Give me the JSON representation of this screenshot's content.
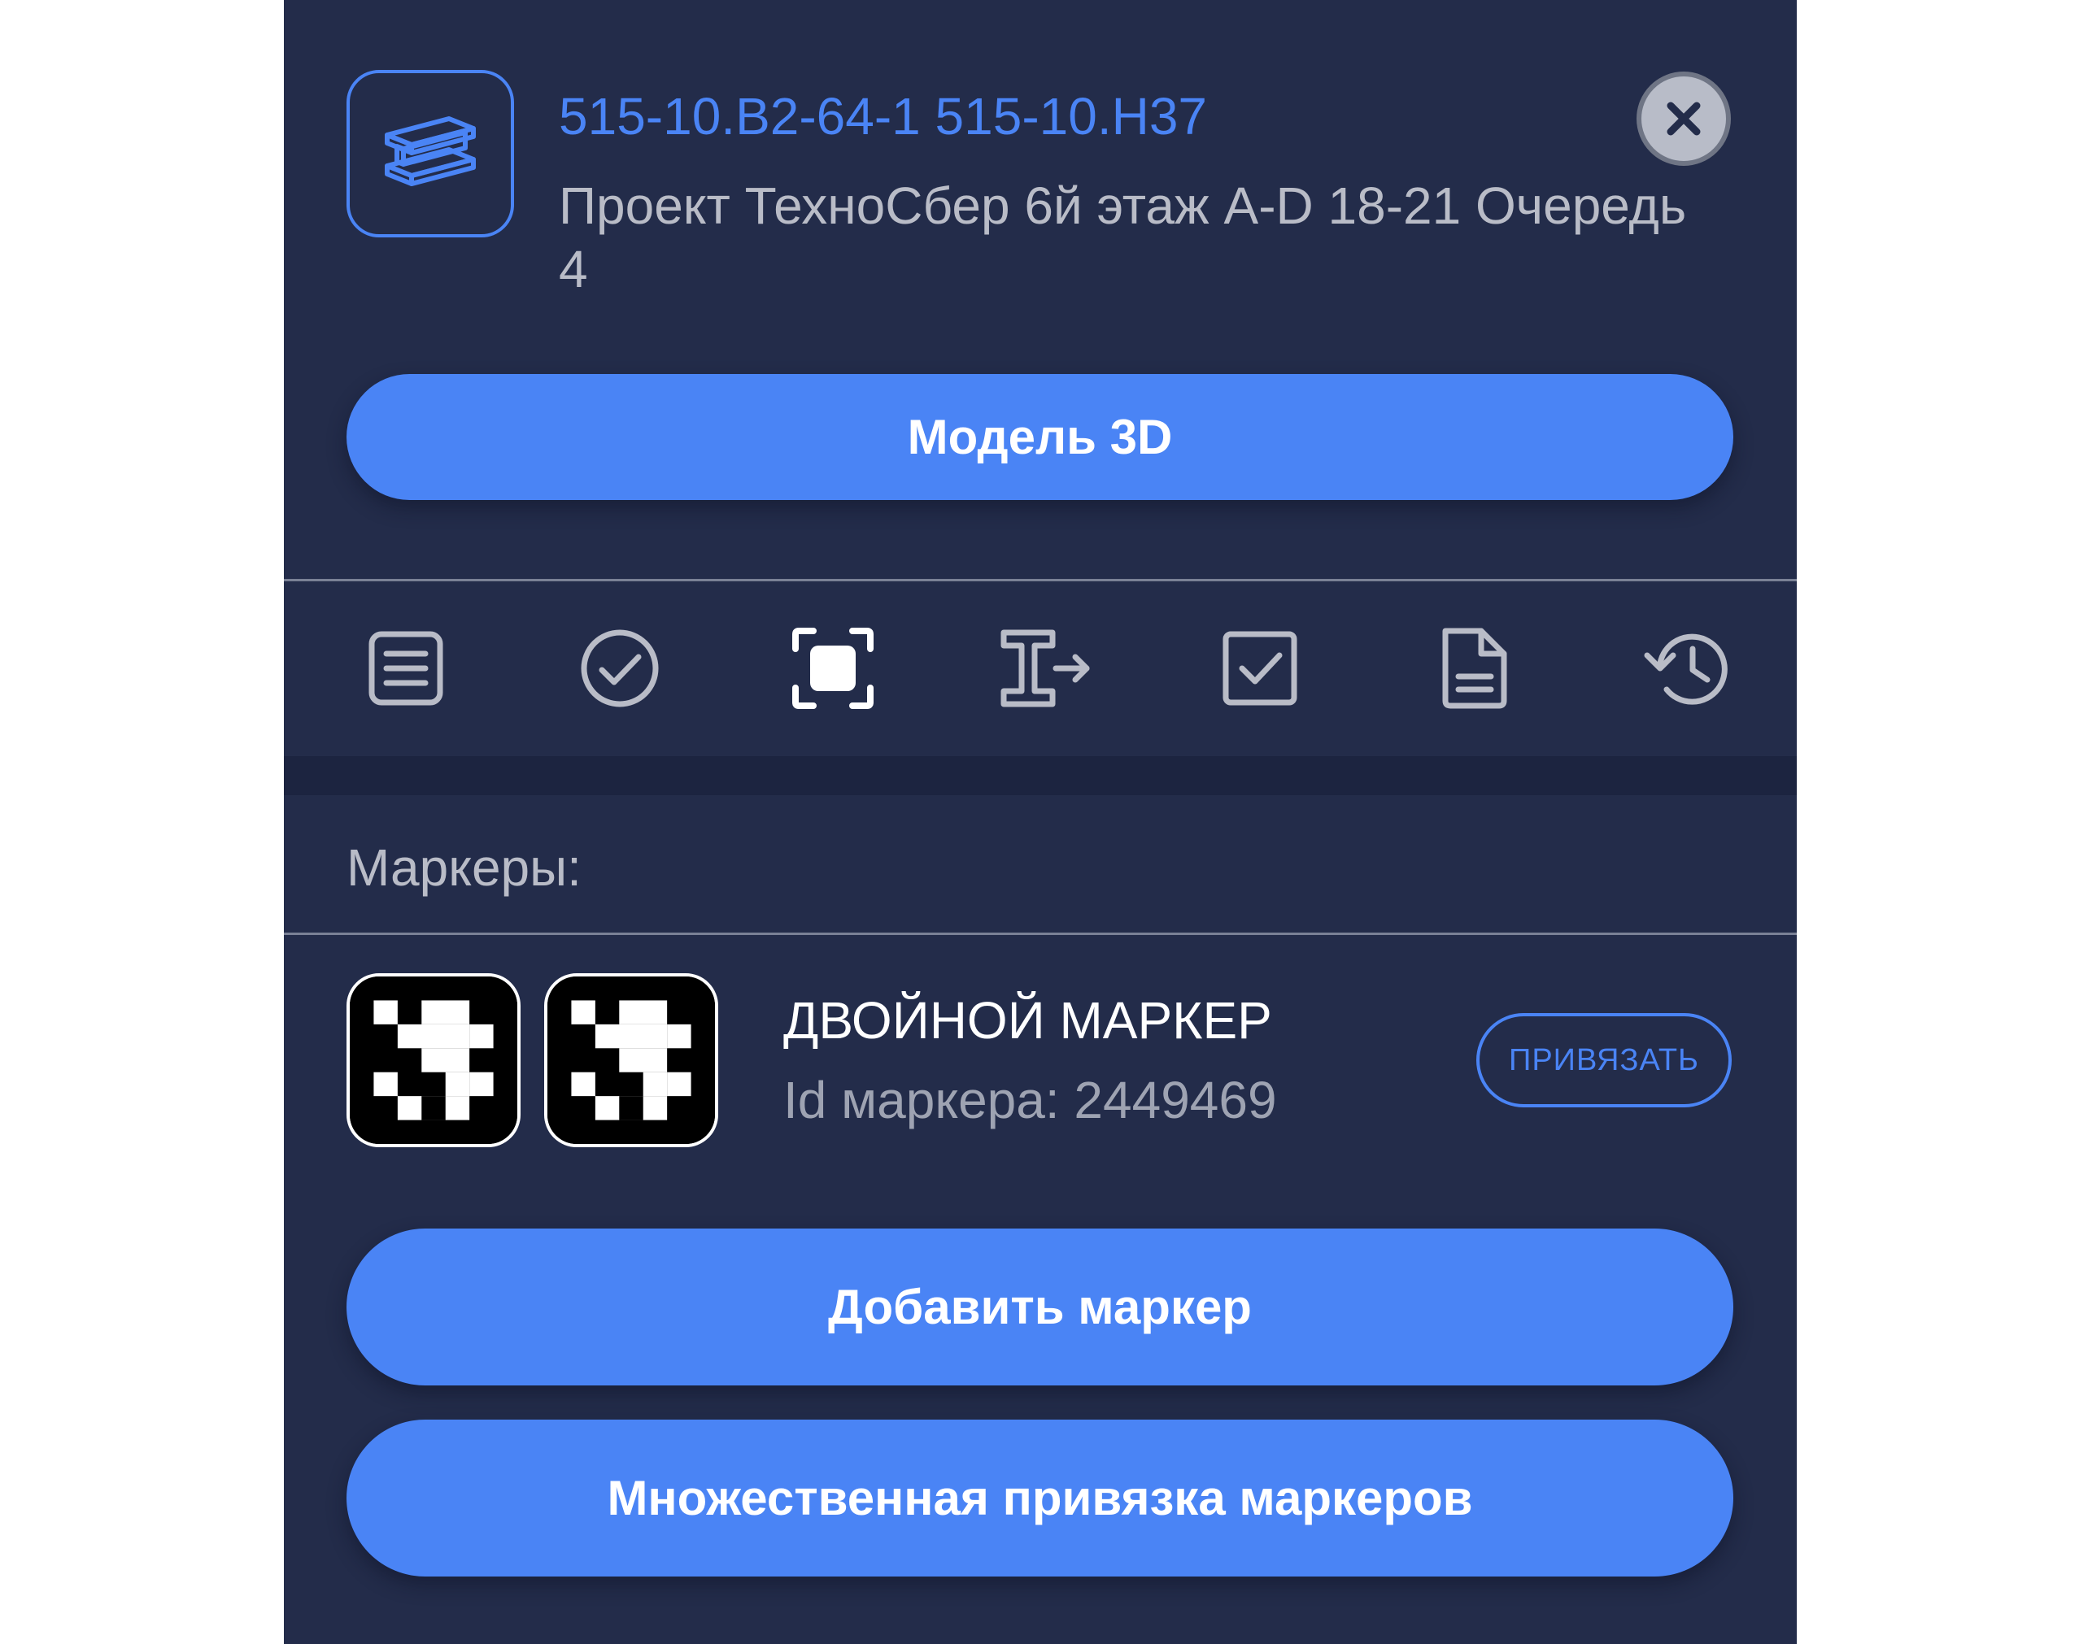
{
  "header": {
    "element_code": "515-10.B2-64-1 515-10.H37",
    "element_description": "Проект ТехноСбер 6й этаж A-D 18-21 Очередь 4",
    "element_icon": "steel-beam-icon",
    "close_icon": "close-icon"
  },
  "actions": {
    "model_3d_label": "Модель 3D",
    "add_marker_label": "Добавить маркер",
    "multi_bind_label": "Множественная привязка маркеров"
  },
  "tabs": [
    {
      "icon": "list-document-icon",
      "active": false
    },
    {
      "icon": "check-circle-icon",
      "active": false
    },
    {
      "icon": "marker-frame-icon",
      "active": true
    },
    {
      "icon": "beam-transfer-icon",
      "active": false
    },
    {
      "icon": "checkbox-icon",
      "active": false
    },
    {
      "icon": "file-icon",
      "active": false
    },
    {
      "icon": "history-icon",
      "active": false
    }
  ],
  "markers": {
    "heading": "Маркеры:",
    "item": {
      "title": "ДВОЙНОЙ МАРКЕР",
      "id_label": "Id маркера:",
      "id_value": "2449469",
      "bind_label": "ПРИВЯЗАТЬ"
    }
  },
  "colors": {
    "background": "#232c4a",
    "accent": "#4a84f5",
    "icon_inactive": "#b9bcc7",
    "icon_active": "#ffffff"
  }
}
